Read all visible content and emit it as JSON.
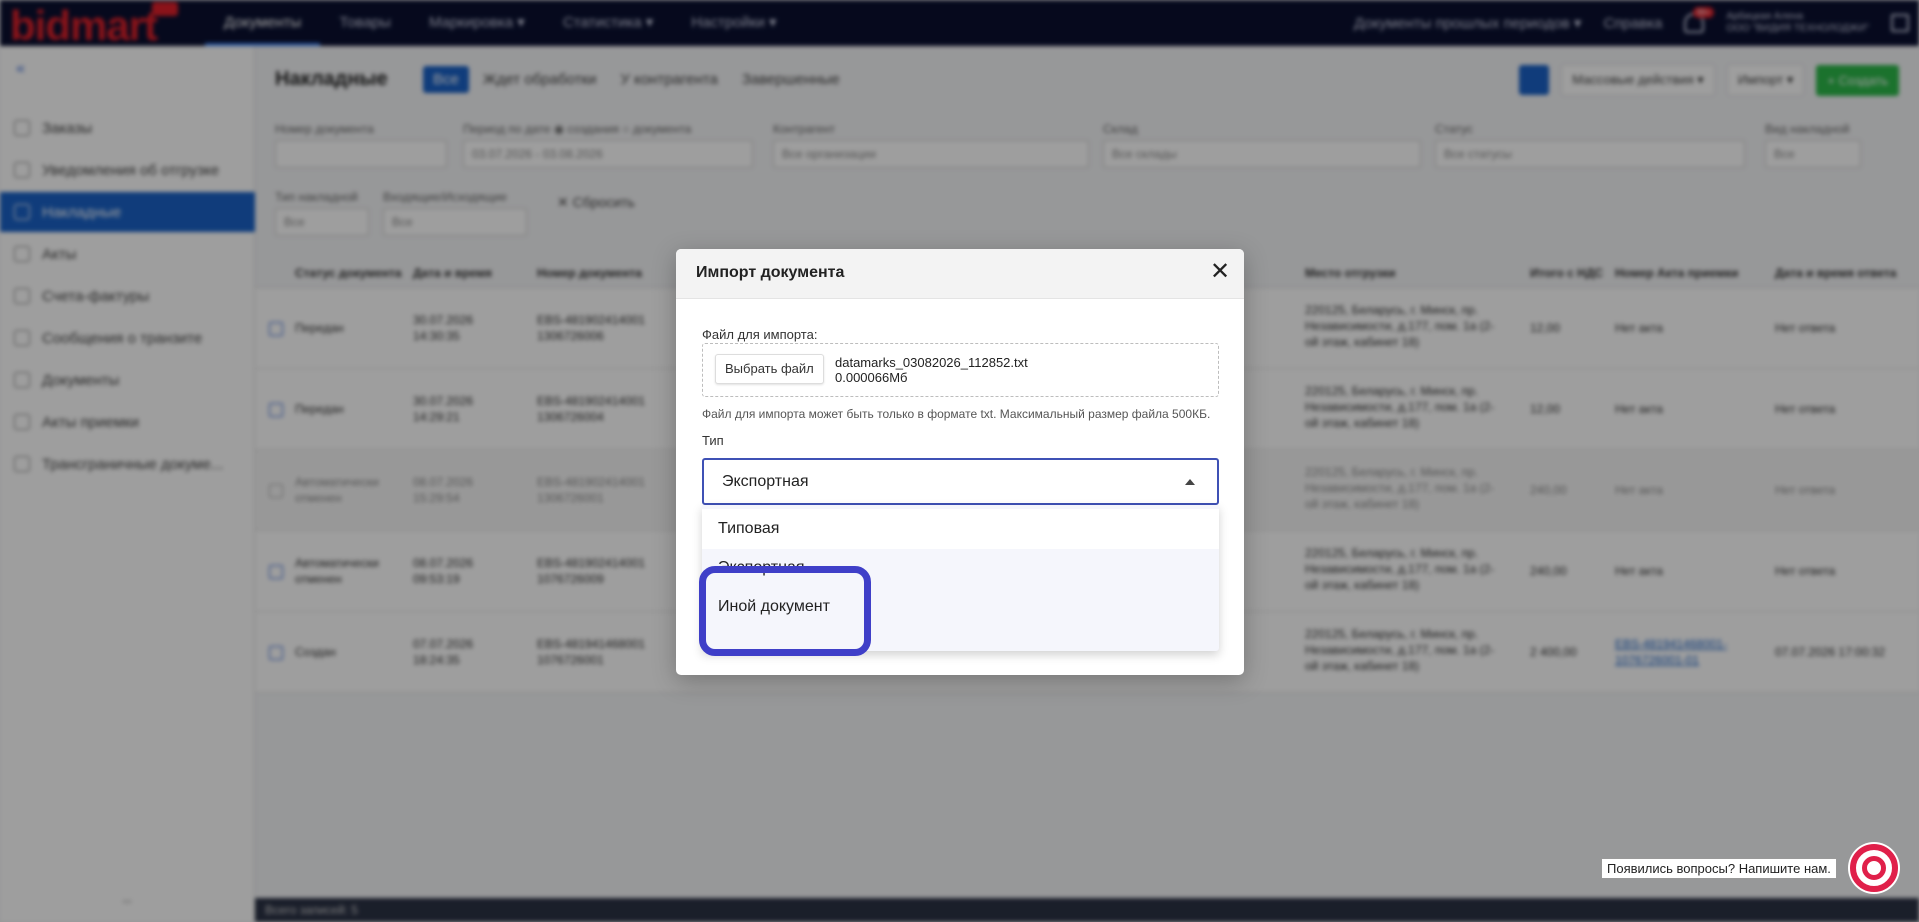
{
  "app": {
    "logo": "bidmart",
    "logo_badge": "",
    "nav": [
      "Документы",
      "Товары",
      "Маркировка ▾",
      "Статистика ▾",
      "Настройки ▾"
    ],
    "top_right": {
      "periods": "Документы прошлых периодов ▾",
      "help": "Справка",
      "bell_count": "99+",
      "user_line1": "Арбицкая Алена",
      "user_line2": "ООО \"ВИДИЯ ТЕХНОЛОДЖИ\""
    },
    "sidebar": [
      "Заказы",
      "Уведомления об отгрузке",
      "Накладные",
      "Акты",
      "Счета-фактуры",
      "Сообщения о транзите",
      "Документы",
      "Акты приемки",
      "Трансграничные докуме..."
    ],
    "page_title": "Накладные",
    "tabs": [
      "Все",
      "Ждет обработки",
      "У контрагента",
      "Завершенные"
    ],
    "actions": [
      "Массовые действия ▾",
      "Импорт ▾",
      "+ Создать"
    ],
    "filters": [
      {
        "label": "Номер документа",
        "value": ""
      },
      {
        "label": "Период по дате ◉ создания ○ документа",
        "value": "03.07.2026 - 03.08.2026"
      },
      {
        "label": "Контрагент",
        "value": "Все организации"
      },
      {
        "label": "Склад",
        "value": "Все склады"
      },
      {
        "label": "Статус",
        "value": "Все статусы"
      },
      {
        "label": "Вид накладной",
        "value": "Все"
      },
      {
        "label": "Тип накладной",
        "value": "Все"
      },
      {
        "label": "Входящие/Исходящие",
        "value": "Все"
      }
    ],
    "reset_label": "✕ Сбросить",
    "table_headers": [
      "Статус документа",
      "Дата и время",
      "Номер документа",
      "Место отгрузки",
      "Итого с НДС",
      "Номер Акта приемки",
      "Дата и время ответа"
    ],
    "rows": [
      {
        "status": "Передан",
        "date": "30.07.2026 14:30:35",
        "number": "EBS-481902414001\n1306726006",
        "place": "220125, Беларусь, г. Минск, пр. Независимости, д.177, пом. 1а (2-ой этаж, кабинет 18)",
        "total": "12,00",
        "act": "Нет акта",
        "answer": "Нет ответа"
      },
      {
        "status": "Передан",
        "date": "30.07.2026 14:29:21",
        "number": "EBS-481902414001\n1306726004",
        "place": "220125, Беларусь, г. Минск, пр. Независимости, д.177, пом. 1а (2-ой этаж, кабинет 18)",
        "total": "12,00",
        "act": "Нет акта",
        "answer": "Нет ответа"
      },
      {
        "status": "Автоматически отменен",
        "date": "08.07.2026 15:29:54",
        "number": "EBS-481902414001\n1306726001",
        "place": "220125, Беларусь, г. Минск, пр. Независимости, д.177, пом. 1а (2-ой этаж, кабинет 18)",
        "total": "240,00",
        "act": "Нет акта",
        "answer": "Нет ответа"
      },
      {
        "status": "Автоматически отменен",
        "date": "08.07.2026 09:53:19",
        "number": "EBS-481902414001\n1076726009",
        "place": "220125, Беларусь, г. Минск, пр. Независимости, д.177, пом. 1а (2-ой этаж, кабинет 18)",
        "total": "240,00",
        "act": "Нет акта",
        "answer": "Нет ответа"
      },
      {
        "status": "Создан",
        "date": "07.07.2026 18:24:35",
        "number": "EBS-481941468001\n1076726001",
        "place": "220125, Беларусь, г. Минск, пр. Независимости, д.177, пом. 1а (2-ой этаж, кабинет 18)",
        "total": "2 400,00",
        "act": "EBS-481941468001-1076726001-01",
        "answer": "07.07.2026 17:00:32"
      }
    ],
    "footer": "Всего записей: 5"
  },
  "modal": {
    "title": "Импорт документа",
    "file_label": "Файл для импорта:",
    "file_button": "Выбрать файл",
    "file_name": "datamarks_03082026_112852.txt",
    "file_size": "0.000066Мб",
    "file_hint": "Файл для импорта может быть только в формате txt. Максимальный размер файла 500КБ.",
    "type_label": "Тип",
    "type_value": "Экспортная",
    "options": [
      "Типовая",
      "Экспортная",
      "Иной документ"
    ]
  },
  "help": {
    "text": "Появились вопросы? Напишите нам."
  },
  "colors": {
    "accent": "#3f51b5",
    "highlight": "#3f3fc8",
    "brand": "#e0202a"
  }
}
